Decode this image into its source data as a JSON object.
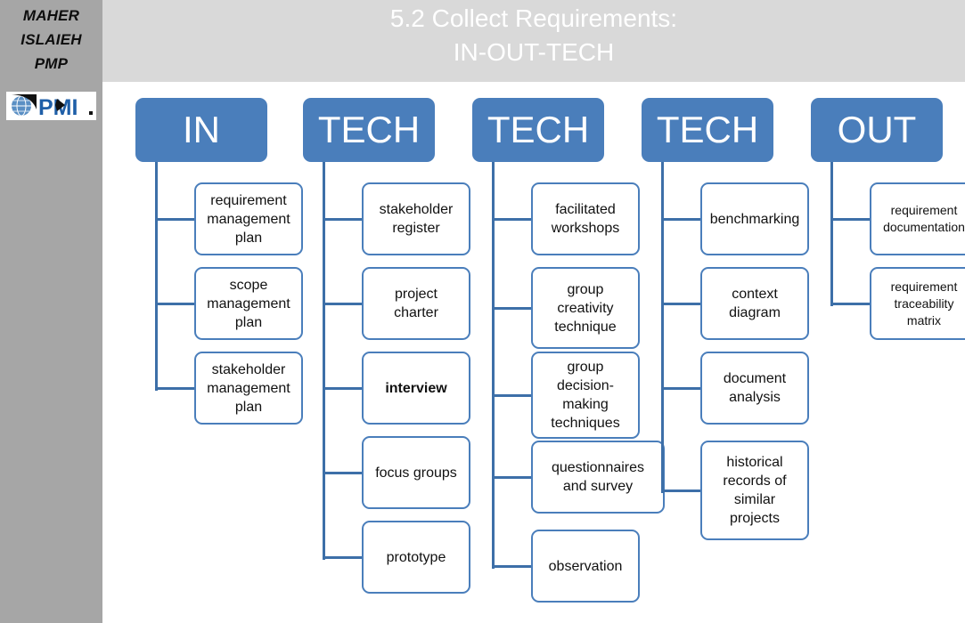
{
  "sidebar": {
    "author_lines": [
      "MAHER",
      "ISLAIEH",
      "PMP"
    ],
    "logo_name": "pmi-logo",
    "logo_text": "PMI",
    "background_color": "#a6a6a6"
  },
  "header": {
    "title_line1": "5.2 Collect Requirements:",
    "title_line2": "IN-OUT-TECH",
    "background_color": "#d9d9d9",
    "text_color": "#ffffff"
  },
  "theme": {
    "header_box_color": "#4a7ebb",
    "node_border_color": "#4a7ebb",
    "connector_color": "#3d6fa8",
    "node_background": "#ffffff"
  },
  "diagram": {
    "type": "tree",
    "columns": [
      {
        "label": "IN",
        "nodes": [
          {
            "text": "requirement management plan",
            "lines": [
              "requirement",
              "management",
              "plan"
            ],
            "bold": false
          },
          {
            "text": "scope management plan",
            "lines": [
              "scope",
              "management",
              "plan"
            ],
            "bold": false
          },
          {
            "text": "stakeholder management plan",
            "lines": [
              "stakeholder",
              "management",
              "plan"
            ],
            "bold": false
          }
        ]
      },
      {
        "label": "TECH",
        "nodes": [
          {
            "text": "stakeholder register",
            "lines": [
              "stakeholder",
              "register"
            ],
            "bold": false
          },
          {
            "text": "project charter",
            "lines": [
              "project",
              "charter"
            ],
            "bold": false
          },
          {
            "text": "interview",
            "lines": [
              "interview"
            ],
            "bold": true
          },
          {
            "text": "focus groups",
            "lines": [
              "focus groups"
            ],
            "bold": false
          },
          {
            "text": "prototype",
            "lines": [
              "prototype"
            ],
            "bold": false
          }
        ]
      },
      {
        "label": "TECH",
        "nodes": [
          {
            "text": "facilitated workshops",
            "lines": [
              "facilitated",
              "workshops"
            ],
            "bold": false
          },
          {
            "text": "group creativity technique",
            "lines": [
              "group",
              "creativity",
              "technique"
            ],
            "bold": false
          },
          {
            "text": "group decision-making techniques",
            "lines": [
              "group",
              "decision-",
              "making",
              "techniques"
            ],
            "bold": false
          },
          {
            "text": "questionnaires and survey",
            "lines": [
              "questionnaires",
              "and survey"
            ],
            "bold": false
          },
          {
            "text": "observation",
            "lines": [
              "observation"
            ],
            "bold": false
          }
        ]
      },
      {
        "label": "TECH",
        "nodes": [
          {
            "text": "benchmarking",
            "lines": [
              "benchmarking"
            ],
            "bold": false
          },
          {
            "text": "context diagram",
            "lines": [
              "context",
              "diagram"
            ],
            "bold": false
          },
          {
            "text": "document analysis",
            "lines": [
              "document",
              "analysis"
            ],
            "bold": false
          },
          {
            "text": "historical records of similar projects",
            "lines": [
              "historical",
              "records of",
              "similar",
              "projects"
            ],
            "bold": false
          }
        ]
      },
      {
        "label": "OUT",
        "nodes": [
          {
            "text": "requirement documentation",
            "lines": [
              "requirement",
              "documentation"
            ],
            "bold": false
          },
          {
            "text": "requirement traceability matrix",
            "lines": [
              "requirement",
              "traceability",
              "matrix"
            ],
            "bold": false
          }
        ]
      }
    ]
  }
}
